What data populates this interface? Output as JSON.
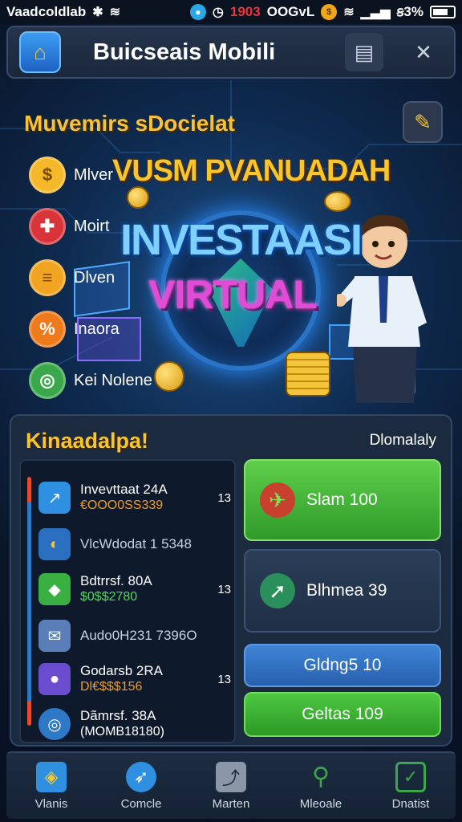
{
  "status_bar": {
    "left_text": "Vaadcoldlab",
    "time": "1903",
    "mid_text": "OOGvL",
    "battery_text": "ꞩ3%"
  },
  "app_bar": {
    "title": "Buicseais Mobili",
    "logo_icon": "wallet-icon",
    "icons": [
      "clipboard-icon",
      "close-icon"
    ]
  },
  "hero": {
    "subtitle": "Muvemirs sDocielat",
    "promo_top": "VUSM PVANUADAH",
    "promo_line1": "INVESTAASI",
    "promo_line2": "VIRTUAL",
    "side_items": [
      {
        "label": "Mlver",
        "icon": "dollar-coin-icon",
        "color": "#f4b82a"
      },
      {
        "label": "Moirt",
        "icon": "chart-icon",
        "color": "#d8343a"
      },
      {
        "label": "Dlven",
        "icon": "money-icon",
        "color": "#f0a422"
      },
      {
        "label": "Inaora",
        "icon": "percent-icon",
        "color": "#ee7a1c"
      },
      {
        "label": "Kei Nolene",
        "icon": "globe-icon",
        "color": "#3aa84a"
      }
    ]
  },
  "portfolio": {
    "title": "Kinaadalpa!",
    "link": "Dlomalaly",
    "rows": [
      {
        "name": "Invevttaat 24A",
        "value": "€OOO0SS339",
        "value_style": "orange",
        "count": "13",
        "icon_color": "#2f8fe0",
        "icon": "chart-icon"
      },
      {
        "single": "VlcWdodat 1 5348",
        "icon_color": "#2b6fc0",
        "icon": "coin-icon"
      },
      {
        "name": "Bdtrrsf. 80A",
        "value": "$0$$2780",
        "value_style": "green",
        "count": "13",
        "icon_color": "#3ab042",
        "icon": "diamond-icon"
      },
      {
        "single": "Audo0H231 7396O",
        "icon_color": "#5a7fb8",
        "icon": "mail-icon"
      },
      {
        "name": "Godarsb 2RA",
        "value": "Dl€$$$156",
        "value_style": "orange",
        "count": "13",
        "icon_color": "#6a4ccf",
        "icon": "circle-icon"
      },
      {
        "name": "Dãmrsf. 38A",
        "value": "(MOMB18180)",
        "value_style": "white",
        "count": "",
        "icon_color": "#2d79c8",
        "icon": "target-icon"
      }
    ],
    "actions": [
      {
        "label": "Slam 100",
        "style": "green",
        "icon": "rocket-icon"
      },
      {
        "label": "Blhmea 39",
        "style": "dark",
        "icon": "trend-arrow-icon"
      },
      {
        "label": "Gldng5 10",
        "style": "blue"
      },
      {
        "label": "Geltas 109",
        "style": "green2"
      }
    ]
  },
  "bottom_nav": [
    {
      "label": "Vlanis",
      "icon": "portfolio-icon",
      "color": "#2f8fe0"
    },
    {
      "label": "Comcle",
      "icon": "rocket-icon",
      "color": "#2f8fe0"
    },
    {
      "label": "Marten",
      "icon": "market-chart-icon",
      "color": "#6b7b90"
    },
    {
      "label": "Mleoale",
      "icon": "search-icon",
      "color": "#3aa84a"
    },
    {
      "label": "Dnatist",
      "icon": "checklist-icon",
      "color": "#3aa84a"
    }
  ]
}
